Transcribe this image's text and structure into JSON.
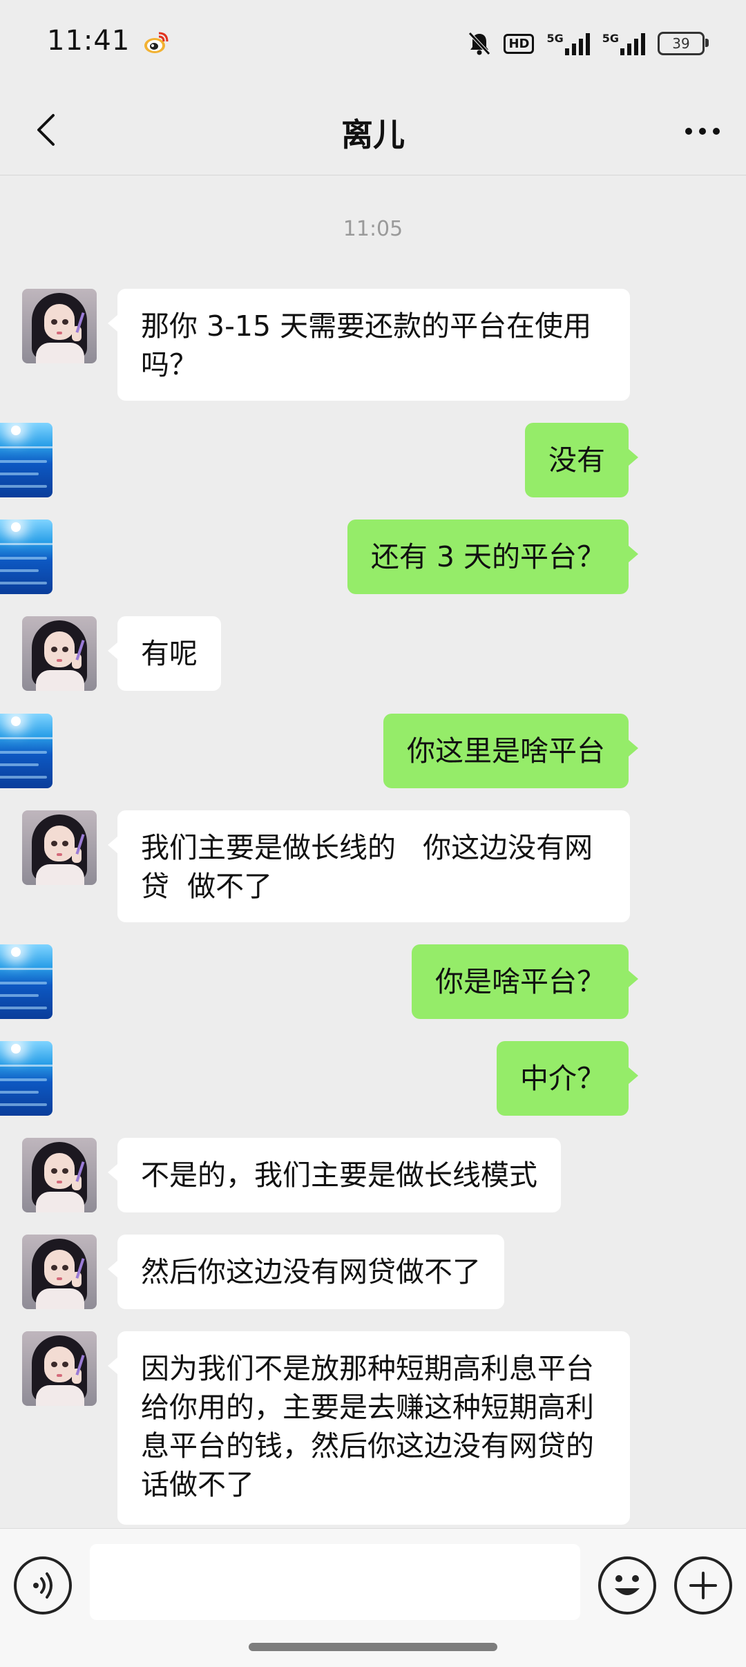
{
  "status_bar": {
    "time": "11:41",
    "notification_icon": "weibo-icon",
    "icons": [
      "mute-bell-icon",
      "hd-icon",
      "signal-5g-icon",
      "signal-5g-icon"
    ],
    "hd_label": "HD",
    "network_1": "5G",
    "network_2": "5G",
    "battery": "39"
  },
  "header": {
    "back_icon": "chevron-left-icon",
    "title": "离儿",
    "more_icon": "more-dots-icon"
  },
  "chat": {
    "timestamp": "11:05",
    "messages": [
      {
        "side": "left",
        "avatar": "contact-avatar-girl",
        "text": "那你 3-15 天需要还款的平台在使用吗？"
      },
      {
        "side": "right",
        "avatar": "my-avatar-sea",
        "text": "没有"
      },
      {
        "side": "right",
        "avatar": "my-avatar-sea",
        "text": "还有 3 天的平台？"
      },
      {
        "side": "left",
        "avatar": "contact-avatar-girl",
        "text": "有呢"
      },
      {
        "side": "right",
        "avatar": "my-avatar-sea",
        "text": "你这里是啥平台"
      },
      {
        "side": "left",
        "avatar": "contact-avatar-girl",
        "text": "我们主要是做长线的   你这边没有网贷  做不了"
      },
      {
        "side": "right",
        "avatar": "my-avatar-sea",
        "text": "你是啥平台？"
      },
      {
        "side": "right",
        "avatar": "my-avatar-sea",
        "text": "中介？"
      },
      {
        "side": "left",
        "avatar": "contact-avatar-girl",
        "text": "不是的，我们主要是做长线模式"
      },
      {
        "side": "left",
        "avatar": "contact-avatar-girl",
        "text": "然后你这边没有网贷做不了"
      },
      {
        "side": "left",
        "avatar": "contact-avatar-girl",
        "text": "因为我们不是放那种短期高利息平台给你用的，主要是去赚这种短期高利息平台的钱，然后你这边没有网贷的话做不了"
      }
    ]
  },
  "input_bar": {
    "voice_icon": "voice-input-icon",
    "input_value": "",
    "emoji_icon": "emoji-icon",
    "plus_icon": "plus-icon"
  },
  "colors": {
    "background": "#ededed",
    "sent_bubble": "#95ec69",
    "received_bubble": "#ffffff"
  }
}
